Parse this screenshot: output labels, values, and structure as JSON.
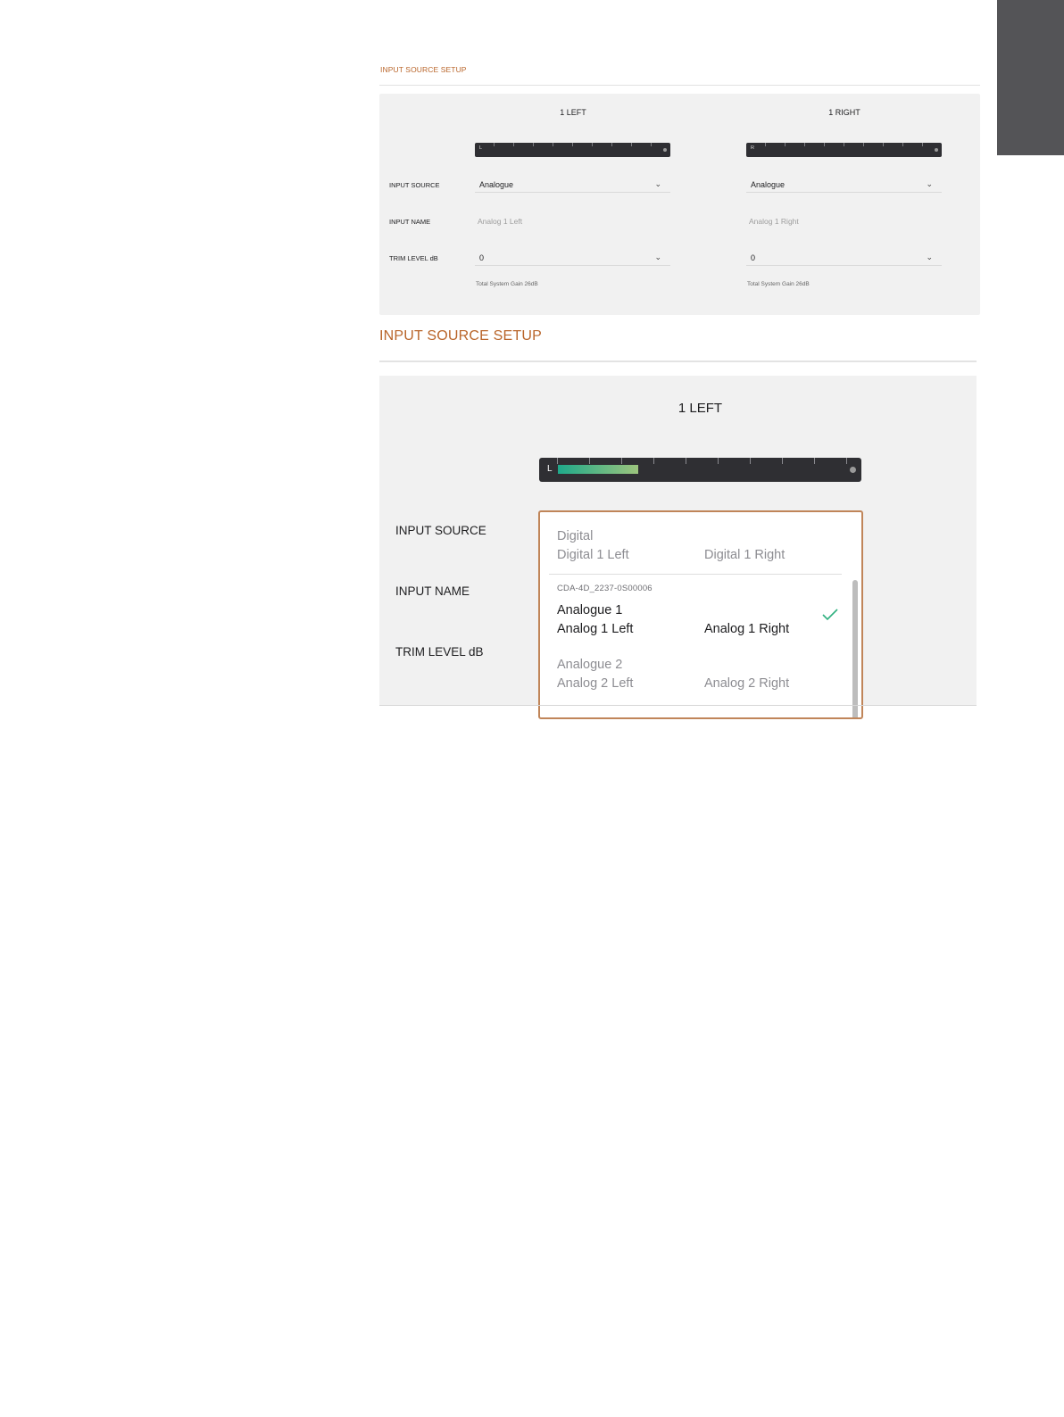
{
  "small_panel": {
    "title": "INPUT SOURCE SETUP",
    "columns": [
      {
        "header": "1 LEFT",
        "meter_label": "L",
        "input_source": "Analogue",
        "input_name": "Analog 1 Left",
        "trim_level": "0",
        "gain_note": "Total System Gain 26dB"
      },
      {
        "header": "1 RIGHT",
        "meter_label": "R",
        "input_source": "Analogue",
        "input_name": "Analog 1 Right",
        "trim_level": "0",
        "gain_note": "Total System Gain 26dB"
      }
    ],
    "row_labels": {
      "input_source": "INPUT SOURCE",
      "input_name": "INPUT NAME",
      "trim_level": "TRIM LEVEL dB"
    }
  },
  "large_panel": {
    "title": "INPUT SOURCE SETUP",
    "column_header": "1 LEFT",
    "meter_label": "L",
    "meter_level_fraction": 0.28,
    "row_labels": {
      "input_source": "INPUT SOURCE",
      "input_name": "INPUT NAME",
      "trim_level": "TRIM LEVEL dB"
    },
    "dropdown": {
      "groups": [
        {
          "label": "Digital",
          "left": "Digital 1 Left",
          "right": "Digital 1 Right"
        }
      ],
      "device": "CDA-4D_2237-0S00006",
      "device_groups": [
        {
          "label": "Analogue 1",
          "left": "Analog 1 Left",
          "right": "Analog 1 Right",
          "selected": true
        },
        {
          "label": "Analogue 2",
          "left": "Analog 2 Left",
          "right": "Analog 2 Right",
          "selected": false
        }
      ]
    }
  },
  "colors": {
    "accent": "#b9652a",
    "side_tab": "#545457",
    "panel_bg": "#f1f1f1",
    "meter_bg": "#2f2f33",
    "check": "#2fb07f"
  },
  "icons": {
    "chevron": "chevron-down-icon",
    "check": "check-icon"
  }
}
